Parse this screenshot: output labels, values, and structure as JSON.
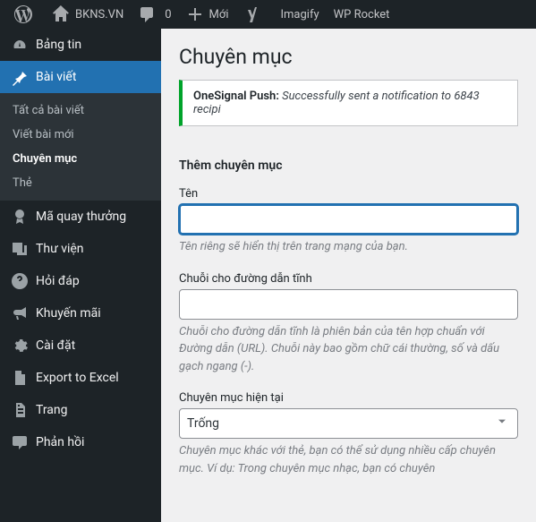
{
  "adminbar": {
    "site_name": "BKNS.VN",
    "comment_count": "0",
    "new_label": "Mới",
    "imagify": "Imagify",
    "wprocket": "WP Rocket"
  },
  "sidebar": {
    "dashboard": "Bảng tin",
    "posts": "Bài viết",
    "posts_submenu": {
      "all": "Tất cả bài viết",
      "new": "Viết bài mới",
      "categories": "Chuyên mục",
      "tags": "Thẻ"
    },
    "lucky": "Mã quay thưởng",
    "media": "Thư viện",
    "faq": "Hỏi đáp",
    "promo": "Khuyến mãi",
    "settings": "Cài đặt",
    "export": "Export to Excel",
    "pages": "Trang",
    "comments": "Phản hồi"
  },
  "page": {
    "title": "Chuyên mục",
    "notice_prefix": "OneSignal Push:",
    "notice_body": "Successfully sent a notification to 6843 recipi"
  },
  "form": {
    "heading": "Thêm chuyên mục",
    "name_label": "Tên",
    "name_value": "",
    "name_desc": "Tên riêng sẽ hiển thị trên trang mạng của bạn.",
    "slug_label": "Chuỗi cho đường dẫn tĩnh",
    "slug_value": "",
    "slug_desc": "Chuỗi cho đường dẫn tĩnh là phiên bản của tên hợp chuẩn với Đường dẫn (URL). Chuỗi này bao gồm chữ cái thường, số và dấu gạch ngang (-).",
    "parent_label": "Chuyên mục hiện tại",
    "parent_value": "Trống",
    "parent_desc": "Chuyên mục khác với thẻ, bạn có thể sử dụng nhiều cấp chuyên mục. Ví dụ: Trong chuyên mục nhạc, bạn có chuyên"
  }
}
